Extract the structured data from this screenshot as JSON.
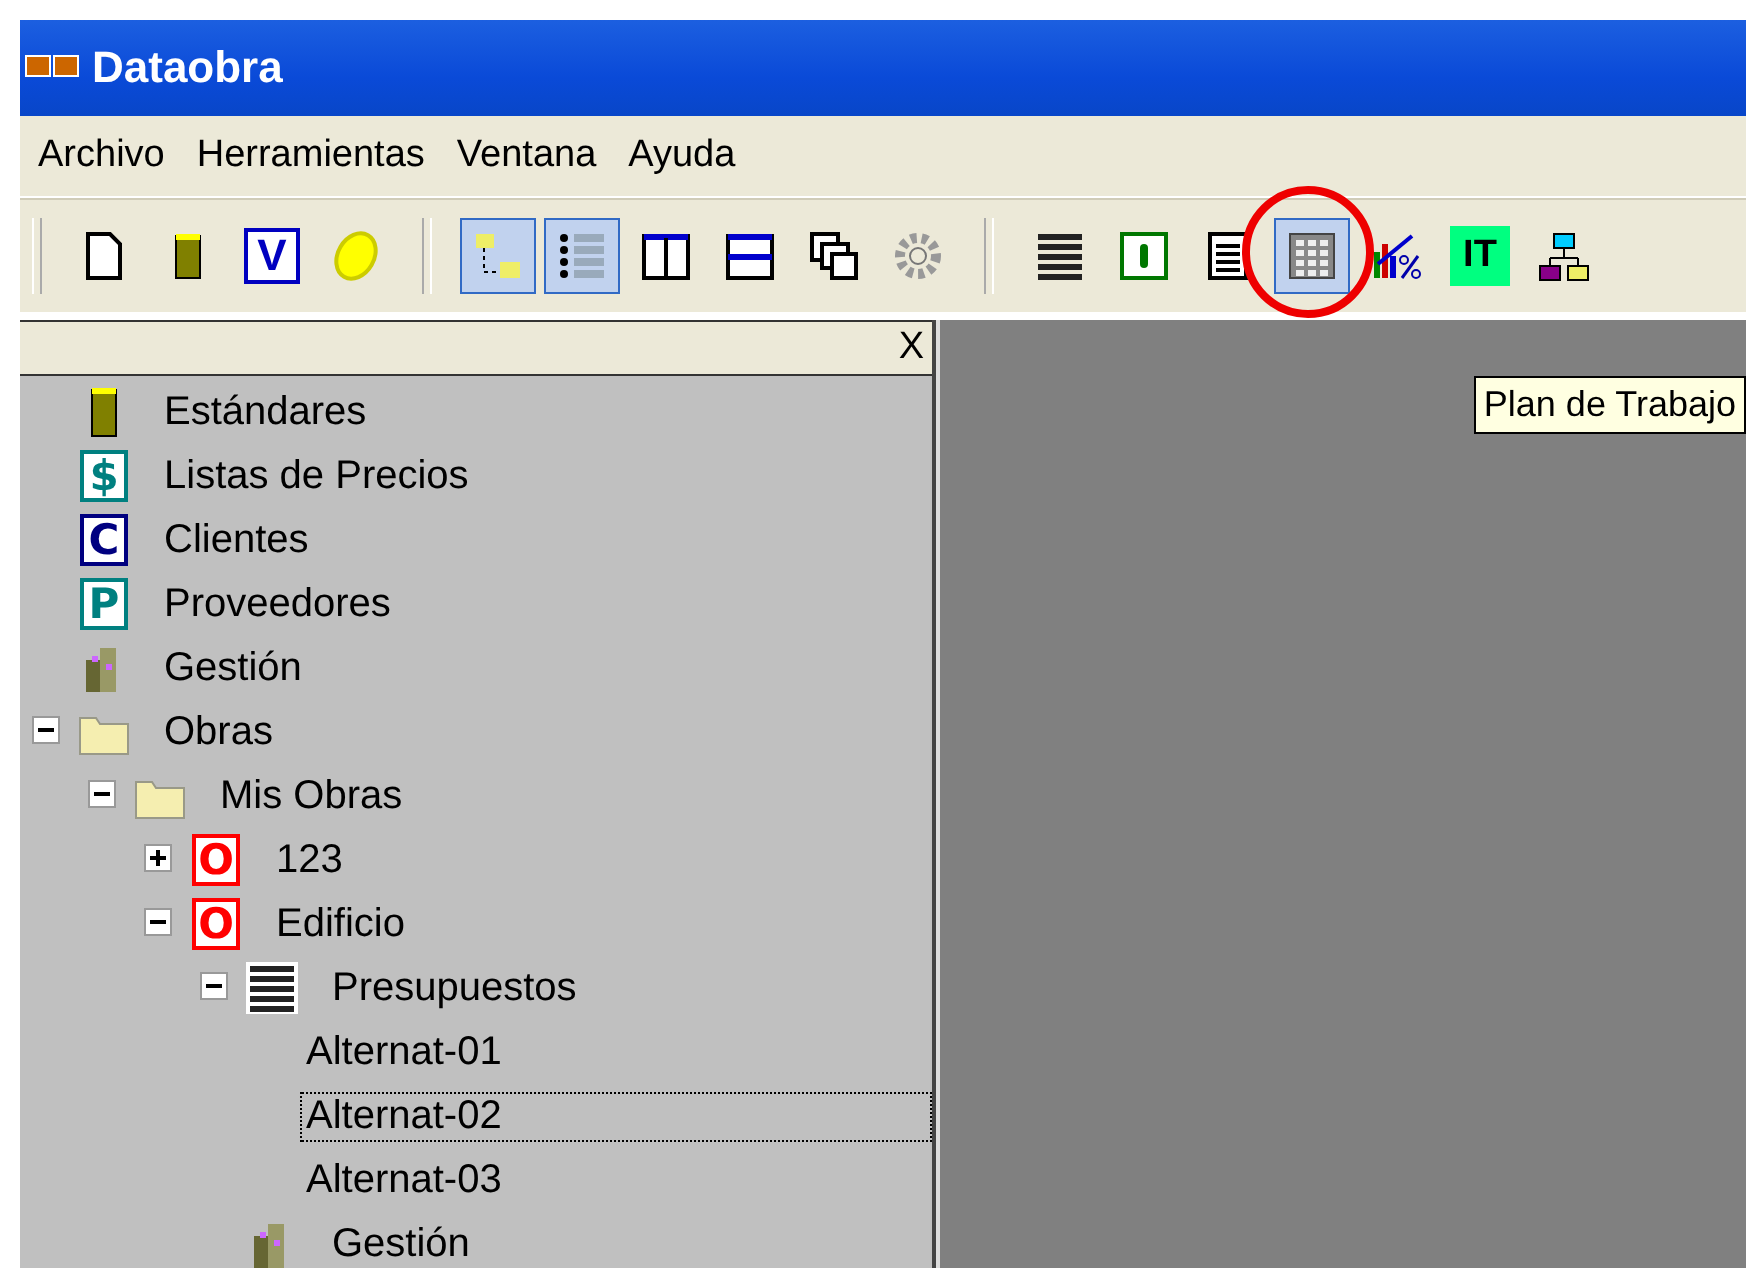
{
  "window": {
    "title": "Dataobra"
  },
  "menu": [
    "Archivo",
    "Herramientas",
    "Ventana",
    "Ayuda"
  ],
  "toolbar": [
    {
      "kind": "document",
      "pressed": false,
      "circled": false
    },
    {
      "kind": "cylinder",
      "pressed": false,
      "circled": false
    },
    {
      "kind": "letter",
      "glyph": "V",
      "pressed": false,
      "circled": false
    },
    {
      "kind": "coin",
      "pressed": false,
      "circled": false
    },
    {
      "kind": "separator"
    },
    {
      "kind": "tree",
      "pressed": true,
      "circled": false
    },
    {
      "kind": "list",
      "pressed": true,
      "circled": false
    },
    {
      "kind": "columns",
      "pressed": false,
      "circled": false
    },
    {
      "kind": "rows",
      "pressed": false,
      "circled": false
    },
    {
      "kind": "windows",
      "pressed": false,
      "circled": false
    },
    {
      "kind": "gear",
      "pressed": false,
      "circled": false
    },
    {
      "kind": "separator"
    },
    {
      "kind": "lines",
      "pressed": false,
      "circled": false
    },
    {
      "kind": "frame",
      "pressed": false,
      "circled": false
    },
    {
      "kind": "report",
      "pressed": false,
      "circled": false
    },
    {
      "kind": "grid",
      "pressed": true,
      "circled": true
    },
    {
      "kind": "chart",
      "pressed": false,
      "circled": false
    },
    {
      "kind": "badge",
      "glyph": "IT",
      "pressed": false,
      "circled": false
    },
    {
      "kind": "org",
      "pressed": false,
      "circled": false
    }
  ],
  "tooltip": "Plan de Trabajo",
  "panel": {
    "close": "X"
  },
  "tree": [
    {
      "label": "Estándares",
      "kind": "cylinder",
      "selected": false
    },
    {
      "label": "Listas de Precios",
      "kind": "letter",
      "glyph": "$",
      "color": "#008080",
      "selected": false
    },
    {
      "label": "Clientes",
      "kind": "letter",
      "glyph": "C",
      "color": "#000080",
      "selected": false
    },
    {
      "label": "Proveedores",
      "kind": "letter",
      "glyph": "P",
      "color": "#008080",
      "selected": false
    },
    {
      "label": "Gestión",
      "kind": "coins",
      "selected": false
    },
    {
      "label": "Obras",
      "kind": "folder",
      "expanded": true,
      "selected": false,
      "children": [
        {
          "label": "Mis Obras",
          "kind": "folder",
          "expanded": true,
          "selected": false,
          "children": [
            {
              "label": "123",
              "kind": "letter",
              "glyph": "O",
              "color": "#ff0000",
              "expanded": false,
              "selected": false
            },
            {
              "label": "Edificio",
              "kind": "letter",
              "glyph": "O",
              "color": "#ff0000",
              "expanded": true,
              "selected": false,
              "children": [
                {
                  "label": "Presupuestos",
                  "kind": "lines",
                  "expanded": true,
                  "selected": false,
                  "children": [
                    {
                      "label": "Alternat-01",
                      "kind": "plain",
                      "selected": false
                    },
                    {
                      "label": "Alternat-02",
                      "kind": "plain",
                      "selected": true
                    },
                    {
                      "label": "Alternat-03",
                      "kind": "plain",
                      "selected": false
                    }
                  ]
                },
                {
                  "label": "Gestión",
                  "kind": "coins",
                  "selected": false
                }
              ]
            }
          ]
        }
      ]
    }
  ]
}
